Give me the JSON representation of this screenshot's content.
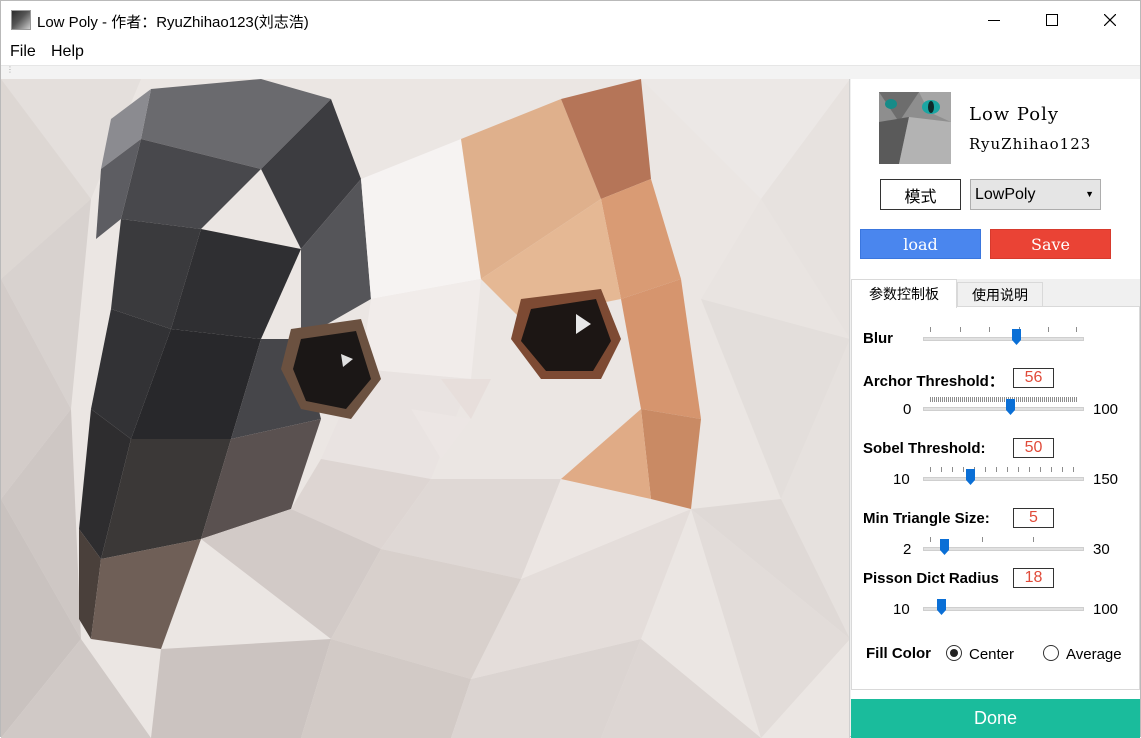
{
  "window": {
    "title": "Low Poly - 作者：RyuZhihao123(刘志浩)",
    "icons": {
      "minimize": "minimize-icon",
      "maximize": "maximize-icon",
      "close": "close-icon"
    }
  },
  "menu": {
    "items": [
      "File",
      "Help"
    ]
  },
  "panel": {
    "brand_title": "Low Poly",
    "brand_author": "RyuZhihao123",
    "mode_label": "模式",
    "mode_value": "LowPoly",
    "load_label": "load",
    "save_label": "Save",
    "colors": {
      "load": "#4a86ee",
      "save": "#ea4335",
      "done": "#1abc9c",
      "value_text": "#e04b3a",
      "slider_handle": "#0a6fd6"
    },
    "tabs": [
      {
        "label": "参数控制板",
        "active": true
      },
      {
        "label": "使用说明",
        "active": false
      }
    ],
    "params": {
      "blur": {
        "label": "Blur",
        "level": 0.58
      },
      "archor": {
        "label": "Archor Threshold：",
        "value": "56",
        "min": "0",
        "max": "100"
      },
      "sobel": {
        "label": "Sobel Threshold:",
        "value": "50",
        "min": "10",
        "max": "150"
      },
      "min_tri": {
        "label": "Min Triangle Size:",
        "value": "5",
        "min": "2",
        "max": "30"
      },
      "pisson": {
        "label": "Pisson Dict Radius",
        "value": "18",
        "min": "10",
        "max": "100"
      }
    },
    "fill_color": {
      "label": "Fill Color",
      "options": [
        "Center",
        "Average"
      ],
      "selected": "Center"
    },
    "done_label": "Done"
  }
}
